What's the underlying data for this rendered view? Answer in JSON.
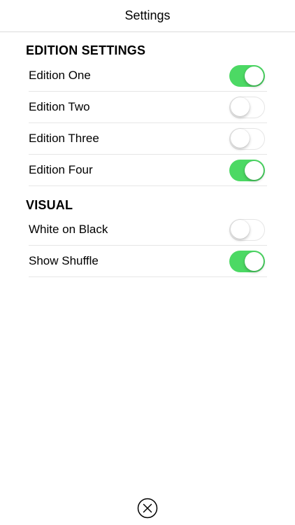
{
  "navbar": {
    "title": "Settings"
  },
  "sections": [
    {
      "header": "EDITION SETTINGS",
      "rows": [
        {
          "label": "Edition One",
          "on": true
        },
        {
          "label": "Edition Two",
          "on": false
        },
        {
          "label": "Edition Three",
          "on": false
        },
        {
          "label": "Edition Four",
          "on": true
        }
      ]
    },
    {
      "header": "VISUAL",
      "rows": [
        {
          "label": "White on Black",
          "on": false
        },
        {
          "label": "Show Shuffle",
          "on": true
        }
      ]
    }
  ],
  "colors": {
    "toggle_on": "#4cd964",
    "toggle_off_border": "#e5e5e5"
  },
  "icons": {
    "close": "close-circle-icon"
  }
}
